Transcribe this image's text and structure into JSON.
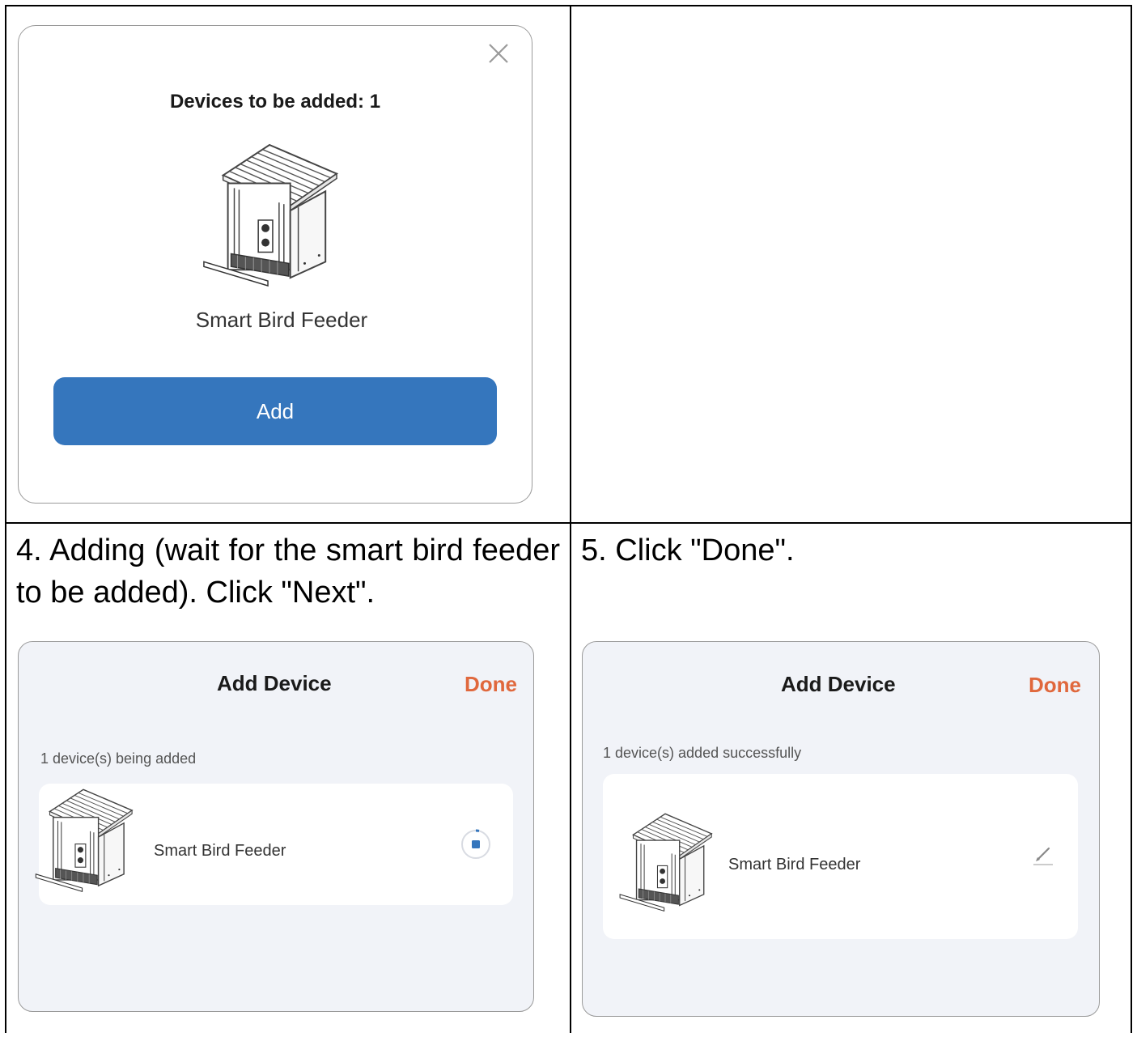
{
  "steps": {
    "step4": {
      "caption": "4. Adding (wait for the smart bird feeder to be added). Click \"Next\"."
    },
    "step5": {
      "caption": "5. Click \"Done\"."
    }
  },
  "confirm_dialog": {
    "title": "Devices to be added: 1",
    "device_name": "Smart Bird Feeder",
    "add_label": "Add",
    "close_icon": "close-icon",
    "accent": "#3576bd"
  },
  "adding_screen": {
    "title": "Add Device",
    "done_label": "Done",
    "status_text": "1 device(s) being added",
    "device_name": "Smart Bird Feeder",
    "progress_icon": "loading-spinner-icon",
    "done_color": "#e0683d"
  },
  "success_screen": {
    "title": "Add Device",
    "done_label": "Done",
    "status_text": "1 device(s) added successfully",
    "device_name": "Smart Bird Feeder",
    "edit_icon": "pencil-icon"
  }
}
